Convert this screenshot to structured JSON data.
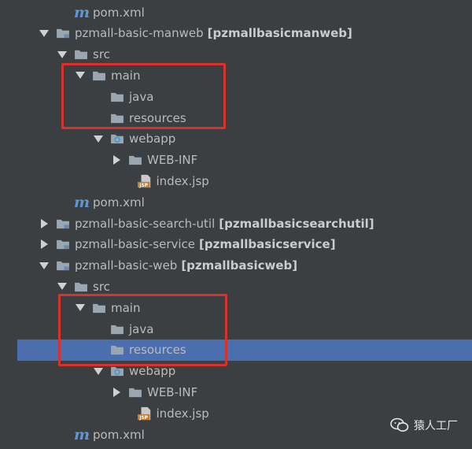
{
  "tree": [
    {
      "indent": 1,
      "arrow": "none",
      "icon": "maven-icon",
      "label": "pom.xml",
      "bold": ""
    },
    {
      "indent": 0,
      "arrow": "down",
      "icon": "module-folder-icon",
      "label": "pzmall-basic-manweb",
      "bold": "[pzmallbasicmanweb]"
    },
    {
      "indent": 1,
      "arrow": "down",
      "icon": "folder-icon",
      "label": "src",
      "bold": ""
    },
    {
      "indent": 2,
      "arrow": "down",
      "icon": "folder-icon",
      "label": "main",
      "bold": ""
    },
    {
      "indent": 3,
      "arrow": "none",
      "icon": "folder-icon",
      "label": "java",
      "bold": ""
    },
    {
      "indent": 3,
      "arrow": "none",
      "icon": "folder-icon",
      "label": "resources",
      "bold": ""
    },
    {
      "indent": 3,
      "arrow": "down",
      "icon": "web-folder-icon",
      "label": "webapp",
      "bold": ""
    },
    {
      "indent": 4,
      "arrow": "right",
      "icon": "folder-icon",
      "label": "WEB-INF",
      "bold": ""
    },
    {
      "indent": 4.5,
      "arrow": "none",
      "icon": "jsp-file-icon",
      "label": "index.jsp",
      "bold": ""
    },
    {
      "indent": 1,
      "arrow": "none",
      "icon": "maven-icon",
      "label": "pom.xml",
      "bold": ""
    },
    {
      "indent": 0,
      "arrow": "right",
      "icon": "module-folder-icon",
      "label": "pzmall-basic-search-util",
      "bold": "[pzmallbasicsearchutil]"
    },
    {
      "indent": 0,
      "arrow": "right",
      "icon": "module-folder-icon",
      "label": "pzmall-basic-service",
      "bold": "[pzmallbasicservice]"
    },
    {
      "indent": 0,
      "arrow": "down",
      "icon": "module-folder-icon",
      "label": "pzmall-basic-web",
      "bold": "[pzmallbasicweb]"
    },
    {
      "indent": 1,
      "arrow": "down",
      "icon": "folder-icon",
      "label": "src",
      "bold": ""
    },
    {
      "indent": 2,
      "arrow": "down",
      "icon": "folder-icon",
      "label": "main",
      "bold": ""
    },
    {
      "indent": 3,
      "arrow": "none",
      "icon": "folder-icon",
      "label": "java",
      "bold": ""
    },
    {
      "indent": 3,
      "arrow": "none",
      "icon": "folder-icon",
      "label": "resources",
      "bold": "",
      "selected": true
    },
    {
      "indent": 3,
      "arrow": "down",
      "icon": "web-folder-icon",
      "label": "webapp",
      "bold": ""
    },
    {
      "indent": 4,
      "arrow": "right",
      "icon": "folder-icon",
      "label": "WEB-INF",
      "bold": ""
    },
    {
      "indent": 4.5,
      "arrow": "none",
      "icon": "jsp-file-icon",
      "label": "index.jsp",
      "bold": ""
    },
    {
      "indent": 1,
      "arrow": "none",
      "icon": "maven-icon",
      "label": "pom.xml",
      "bold": ""
    }
  ],
  "maven_glyph": "m",
  "jsp_badge": "JSP",
  "watermark": {
    "text": "猿人工厂",
    "icon": "wechat-icon"
  },
  "colors": {
    "background": "#3c3f41",
    "selection": "#4b6eaf",
    "highlight_box": "#d9312b",
    "folder": "#9aa7b0",
    "maven": "#5f96d6"
  }
}
